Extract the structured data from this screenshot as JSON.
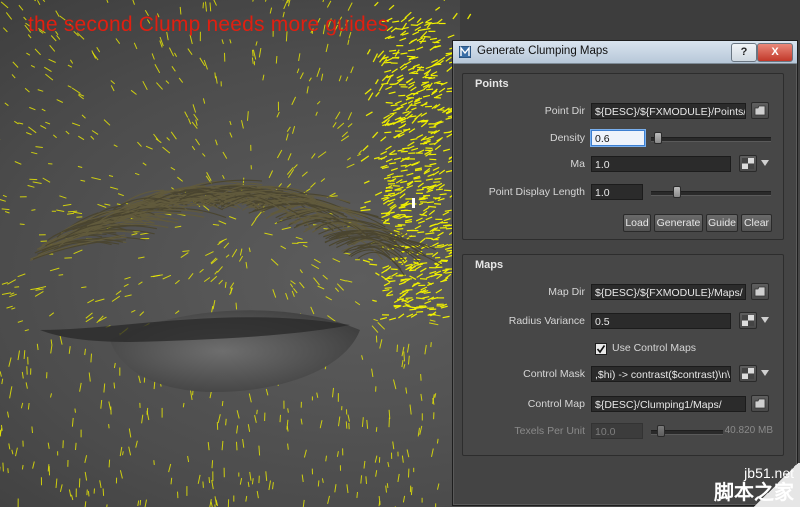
{
  "annotation": {
    "text": "the second Clump needs more guides"
  },
  "watermark": {
    "site": "jb51.net",
    "chinese": "脚本之家"
  },
  "dialog": {
    "title": "Generate Clumping Maps",
    "help_label": "?",
    "close_label": "X",
    "points_group": {
      "title": "Points",
      "point_dir": {
        "label": "Point Dir",
        "value": "${DESC}/${FXMODULE}/Points/"
      },
      "density": {
        "label": "Density",
        "value": "0.6",
        "slider_fraction": 0.03
      },
      "mask": {
        "label": "Ma",
        "value": "1.0"
      },
      "point_display_length": {
        "label": "Point Display Length",
        "value": "1.0",
        "slider_fraction": 0.2
      },
      "buttons": {
        "load": "Load",
        "generate": "Generate",
        "guide": "Guide",
        "clear": "Clear"
      }
    },
    "maps_group": {
      "title": "Maps",
      "map_dir": {
        "label": "Map Dir",
        "value": "${DESC}/${FXMODULE}/Maps/"
      },
      "radius_variance": {
        "label": "Radius Variance",
        "value": "0.5"
      },
      "use_control_maps": {
        "label": "Use Control Maps",
        "checked": true
      },
      "control_mask": {
        "label": "Control Mask",
        "value": ",$hi) -> contrast($contrast)\\n\\n"
      },
      "control_map": {
        "label": "Control Map",
        "value": "${DESC}/Clumping1/Maps/"
      },
      "texels_per_unit": {
        "label": "Texels Per Unit",
        "value": "10.0",
        "memory": "40.820 MB",
        "slider_fraction": 0.1
      }
    }
  },
  "colors": {
    "annotation": "#e01f10",
    "arrow": "#b5140c",
    "guides": "#f0f000",
    "dialog_bg": "#444444"
  }
}
